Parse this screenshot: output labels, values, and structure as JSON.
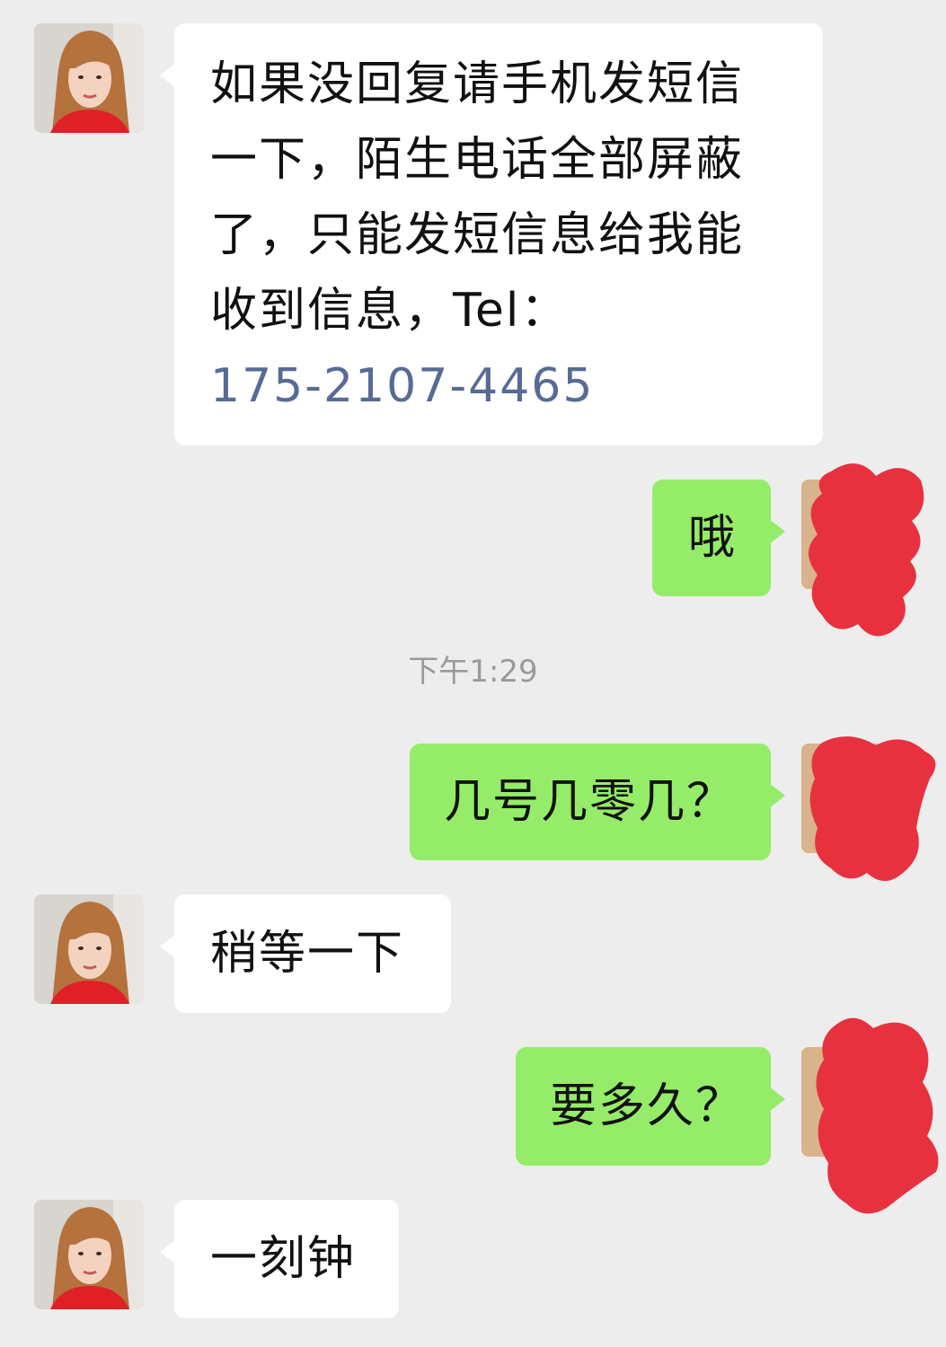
{
  "colors": {
    "background": "#ededed",
    "incoming_bubble": "#ffffff",
    "outgoing_bubble": "#95ec69",
    "link": "#576b95",
    "timestamp": "#9a9a9a",
    "redaction": "#e8313f"
  },
  "messages": [
    {
      "side": "incoming",
      "lines": [
        "如果没回复请手机发短信",
        "一下，陌生电话全部屏蔽",
        "了，只能发短信息给我能",
        "收到信息，Tel："
      ],
      "phone": "175-2107-4465"
    },
    {
      "side": "outgoing",
      "text": "哦"
    },
    {
      "side": "outgoing",
      "text": "几号几零几？"
    },
    {
      "side": "incoming",
      "text": "稍等一下"
    },
    {
      "side": "outgoing",
      "text": "要多久？"
    },
    {
      "side": "incoming",
      "text": "一刻钟"
    }
  ],
  "timestamp": "下午1:29",
  "icons": {
    "contact_avatar": "woman-portrait-avatar",
    "self_avatar": "redacted-avatar"
  }
}
